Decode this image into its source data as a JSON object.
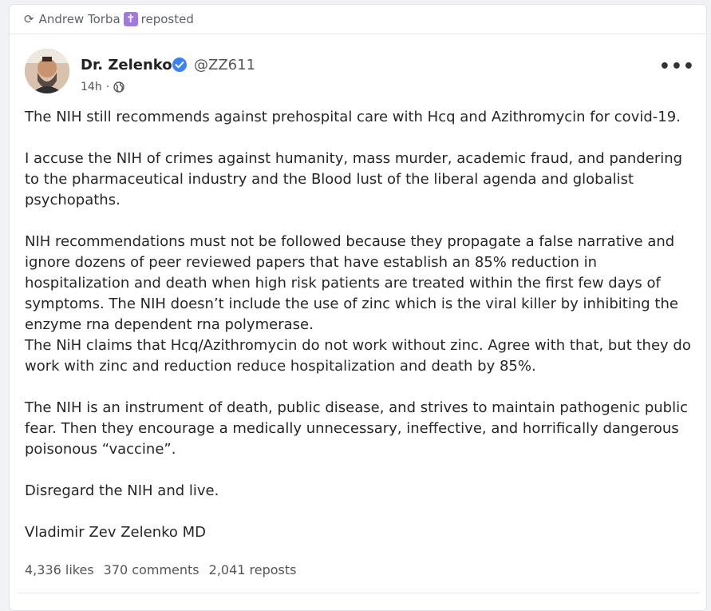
{
  "repost": {
    "icon": "repost-icon",
    "user": "Andrew Torba",
    "badge_glyph": "✝",
    "label": "reposted"
  },
  "post": {
    "author_name": "Dr. Zelenko",
    "verified_icon": "verified-check-icon",
    "handle": "@ZZ611",
    "time": "14h",
    "dot": "·",
    "visibility_icon": "globe-icon",
    "more": "•••",
    "paragraphs": [
      "The NIH still recommends against prehospital care with Hcq and Azithromycin for covid-19.",
      "I accuse the NIH of crimes against humanity, mass murder, academic fraud, and pandering to the pharmaceutical industry and the Blood lust of the liberal agenda and globalist psychopaths.",
      "NIH recommendations must not be followed because they propagate a false narrative and ignore dozens of peer reviewed papers that have establish an 85% reduction in hospitalization and death when high risk patients are treated within the first few days of symptoms. The NIH doesn’t include the use of zinc which is the viral killer by inhibiting the enzyme rna dependent rna polymerase.",
      "The NiH claims that Hcq/Azithromycin do not work without zinc. Agree with that, but they do work with zinc and reduction reduce hospitalization and death by 85%.",
      "The NIH is an instrument of death, public disease, and strives to maintain pathogenic public fear. Then they encourage a medically unnecessary, ineffective, and horrifically dangerous poisonous “vaccine”.",
      "Disregard the NIH and live.",
      "Vladimir Zev Zelenko MD"
    ]
  },
  "stats": {
    "likes": "4,336 likes",
    "comments": "370 comments",
    "reposts": "2,041 reposts"
  },
  "colors": {
    "badge": "#a27bd9",
    "verified": "#3b82f6",
    "background": "#f0f2f5"
  }
}
